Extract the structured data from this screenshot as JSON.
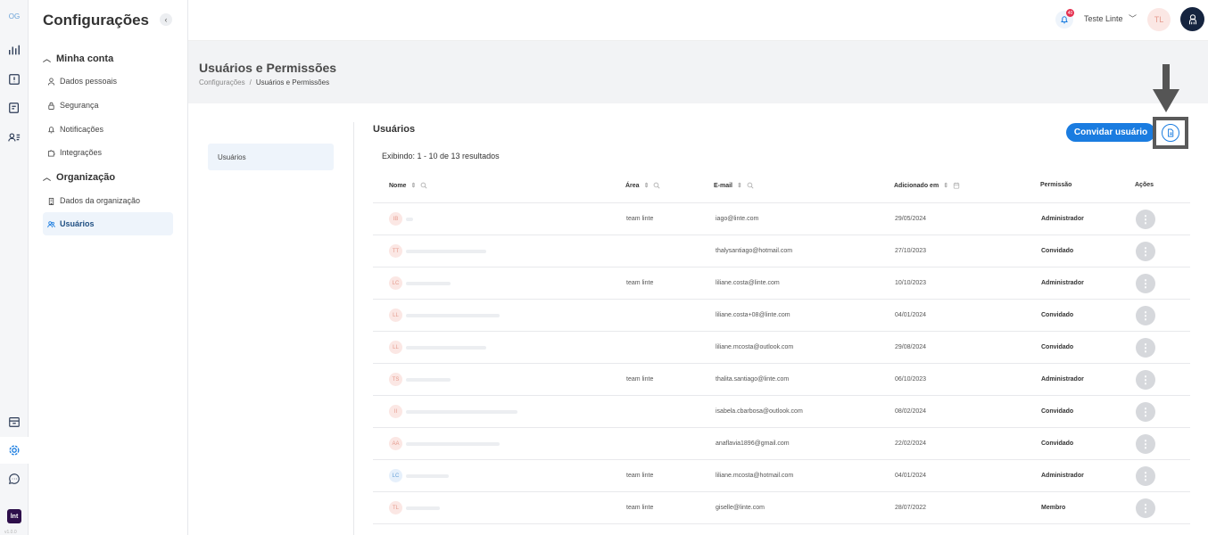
{
  "rail": {
    "logo": "OG",
    "brand": "lnt",
    "version": "v1.0.0"
  },
  "sidebar": {
    "title": "Configurações",
    "collapse": "‹",
    "groups": [
      {
        "label": "Minha conta",
        "items": [
          {
            "label": "Dados pessoais"
          },
          {
            "label": "Segurança"
          },
          {
            "label": "Notificações"
          },
          {
            "label": "Integrações"
          }
        ]
      },
      {
        "label": "Organização",
        "items": [
          {
            "label": "Dados da organização"
          },
          {
            "label": "Usuários"
          }
        ]
      }
    ]
  },
  "topbar": {
    "notifications_count": "40",
    "user_name": "Teste Linte",
    "user_initials": "TL"
  },
  "page": {
    "title": "Usuários e Permissões",
    "breadcrumb": [
      "Configurações",
      "/",
      "Usuários e Permissões"
    ]
  },
  "inner_nav": {
    "item": "Usuários"
  },
  "section": {
    "title": "Usuários",
    "showing": "Exibindo: 1 - 10 de 13 resultados",
    "invite_label": "Convidar usuário"
  },
  "table": {
    "columns": [
      "Nome",
      "Área",
      "E-mail",
      "Adicionado em",
      "Permissão",
      "Ações"
    ],
    "rows": [
      {
        "initials": "IB",
        "area": "team linte",
        "email": "iago@linte.com",
        "date": "29/05/2024",
        "permission": "Administrador"
      },
      {
        "initials": "TT",
        "area": "",
        "email": "thalysantiago@hotmail.com",
        "date": "27/10/2023",
        "permission": "Convidado"
      },
      {
        "initials": "LC",
        "area": "team linte",
        "email": "liliane.costa@linte.com",
        "date": "10/10/2023",
        "permission": "Administrador"
      },
      {
        "initials": "LL",
        "area": "",
        "email": "liliane.costa+08@linte.com",
        "date": "04/01/2024",
        "permission": "Convidado"
      },
      {
        "initials": "LL",
        "area": "",
        "email": "liliane.mcosta@outlook.com",
        "date": "29/08/2024",
        "permission": "Convidado"
      },
      {
        "initials": "TS",
        "area": "team linte",
        "email": "thalita.santiago@linte.com",
        "date": "06/10/2023",
        "permission": "Administrador"
      },
      {
        "initials": "II",
        "area": "",
        "email": "isabela.cbarbosa@outlook.com",
        "date": "08/02/2024",
        "permission": "Convidado"
      },
      {
        "initials": "AA",
        "area": "",
        "email": "anaflavia1896@gmail.com",
        "date": "22/02/2024",
        "permission": "Convidado"
      },
      {
        "initials": "LC",
        "area": "team linte",
        "email": "liliane.mcosta@hotmail.com",
        "date": "04/01/2024",
        "permission": "Administrador"
      },
      {
        "initials": "TL",
        "area": "team linte",
        "email": "giselle@linte.com",
        "date": "28/07/2022",
        "permission": "Membro"
      }
    ]
  },
  "colors": {
    "primary": "#1a7ce0",
    "active_bg": "#eef4fb",
    "avatar_bg": "#fbe7e4",
    "avatar_blue_bg": "#e6f0fb"
  }
}
